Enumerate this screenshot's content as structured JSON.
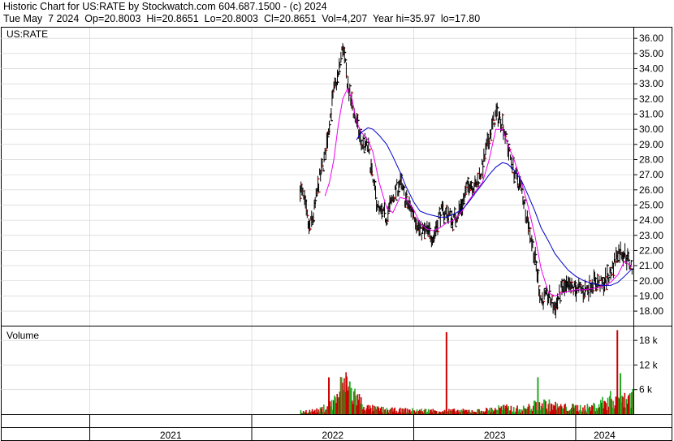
{
  "header": {
    "line1": "Historic Chart for US:RATE by Stockwatch.com 604.687.1500 - (c) 2024",
    "line2": "Tue May  7 2024  Op=20.8003  Hi=20.8651  Lo=20.8003  Cl=20.8651  Vol=4,207  Year hi=35.97  lo=17.80"
  },
  "colors": {
    "price_bar": "#000000",
    "down_close": "#cc0000",
    "ma_short": "#ee00ee",
    "ma_long": "#0000cc",
    "vol_up": "#22aa22",
    "vol_down": "#cc0000",
    "grid": "#cccccc"
  },
  "chart_data": [
    {
      "type": "line",
      "panel": "price",
      "title": "US:RATE",
      "ylim": [
        17.2,
        36.6
      ],
      "yticks": [
        "36.00",
        "35.00",
        "34.00",
        "33.00",
        "32.00",
        "31.00",
        "30.00",
        "29.00",
        "28.00",
        "27.00",
        "26.00",
        "25.00",
        "24.00",
        "23.00",
        "22.00",
        "21.00",
        "20.00",
        "19.00",
        "18.00"
      ],
      "x_labels": [
        "2021",
        "2022",
        "2023",
        "2024"
      ],
      "grid": true,
      "price_path": [
        [
          "2022-04-20",
          26.2
        ],
        [
          "2022-05-01",
          25.0
        ],
        [
          "2022-05-10",
          23.4
        ],
        [
          "2022-05-20",
          24.3
        ],
        [
          "2022-06-01",
          26.5
        ],
        [
          "2022-06-15",
          28.2
        ],
        [
          "2022-06-25",
          30.5
        ],
        [
          "2022-07-05",
          32.5
        ],
        [
          "2022-07-15",
          33.5
        ],
        [
          "2022-07-25",
          35.5
        ],
        [
          "2022-08-05",
          33.0
        ],
        [
          "2022-08-15",
          31.5
        ],
        [
          "2022-08-25",
          30.5
        ],
        [
          "2022-09-05",
          29.0
        ],
        [
          "2022-09-20",
          28.8
        ],
        [
          "2022-10-01",
          26.5
        ],
        [
          "2022-10-15",
          24.5
        ],
        [
          "2022-11-01",
          24.2
        ],
        [
          "2022-11-15",
          25.5
        ],
        [
          "2022-12-01",
          26.5
        ],
        [
          "2022-12-15",
          25.2
        ],
        [
          "2023-01-01",
          24.5
        ],
        [
          "2023-01-15",
          23.3
        ],
        [
          "2023-02-01",
          23.2
        ],
        [
          "2023-02-15",
          22.9
        ],
        [
          "2023-03-01",
          24.5
        ],
        [
          "2023-03-15",
          24.5
        ],
        [
          "2023-04-01",
          24.0
        ],
        [
          "2023-04-20",
          25.0
        ],
        [
          "2023-05-05",
          26.5
        ],
        [
          "2023-05-20",
          26.2
        ],
        [
          "2023-06-05",
          27.5
        ],
        [
          "2023-06-20",
          29.5
        ],
        [
          "2023-07-05",
          31.0
        ],
        [
          "2023-07-20",
          30.5
        ],
        [
          "2023-08-01",
          28.8
        ],
        [
          "2023-08-15",
          27.2
        ],
        [
          "2023-09-01",
          26.0
        ],
        [
          "2023-09-15",
          24.0
        ],
        [
          "2023-10-01",
          21.5
        ],
        [
          "2023-10-15",
          18.7
        ],
        [
          "2023-11-01",
          19.0
        ],
        [
          "2023-11-15",
          18.2
        ],
        [
          "2023-12-01",
          19.5
        ],
        [
          "2023-12-15",
          19.5
        ],
        [
          "2024-01-01",
          19.5
        ],
        [
          "2024-01-20",
          19.3
        ],
        [
          "2024-02-10",
          20.0
        ],
        [
          "2024-03-01",
          19.7
        ],
        [
          "2024-03-20",
          20.5
        ],
        [
          "2024-04-05",
          22.0
        ],
        [
          "2024-04-20",
          21.8
        ],
        [
          "2024-05-07",
          20.8651
        ]
      ],
      "series": [
        {
          "name": "",
          "role": "short moving average",
          "color": "#ee00ee",
          "points": [
            [
              "2022-06-15",
              25.6
            ],
            [
              "2022-06-25",
              26.5
            ],
            [
              "2022-07-05",
              28.0
            ],
            [
              "2022-07-15",
              30.3
            ],
            [
              "2022-07-25",
              32.0
            ],
            [
              "2022-08-05",
              32.7
            ],
            [
              "2022-08-15",
              32.0
            ],
            [
              "2022-08-25",
              30.5
            ],
            [
              "2022-09-05",
              29.8
            ],
            [
              "2022-09-20",
              29.3
            ],
            [
              "2022-10-01",
              28.5
            ],
            [
              "2022-10-15",
              26.5
            ],
            [
              "2022-11-01",
              24.8
            ],
            [
              "2022-11-15",
              24.5
            ],
            [
              "2022-12-01",
              25.5
            ],
            [
              "2022-12-15",
              25.4
            ],
            [
              "2023-01-01",
              24.7
            ],
            [
              "2023-01-15",
              23.8
            ],
            [
              "2023-02-01",
              23.4
            ],
            [
              "2023-02-15",
              23.3
            ],
            [
              "2023-03-01",
              23.5
            ],
            [
              "2023-03-15",
              23.8
            ],
            [
              "2023-04-01",
              24.0
            ],
            [
              "2023-04-20",
              24.6
            ],
            [
              "2023-05-05",
              25.3
            ],
            [
              "2023-05-20",
              25.9
            ],
            [
              "2023-06-05",
              26.5
            ],
            [
              "2023-06-20",
              28.0
            ],
            [
              "2023-07-05",
              30.0
            ],
            [
              "2023-07-20",
              30.0
            ],
            [
              "2023-08-01",
              29.0
            ],
            [
              "2023-08-15",
              28.0
            ],
            [
              "2023-09-01",
              26.5
            ],
            [
              "2023-09-15",
              25.0
            ],
            [
              "2023-10-01",
              23.0
            ],
            [
              "2023-10-15",
              20.8
            ],
            [
              "2023-11-01",
              19.2
            ],
            [
              "2023-11-15",
              19.0
            ],
            [
              "2023-12-01",
              19.2
            ],
            [
              "2023-12-15",
              19.3
            ],
            [
              "2024-01-01",
              19.4
            ],
            [
              "2024-01-20",
              19.4
            ],
            [
              "2024-02-10",
              19.5
            ],
            [
              "2024-03-01",
              19.6
            ],
            [
              "2024-03-20",
              19.9
            ],
            [
              "2024-04-05",
              20.4
            ],
            [
              "2024-04-20",
              21.3
            ],
            [
              "2024-05-07",
              20.9
            ]
          ]
        },
        {
          "name": "",
          "role": "long moving average",
          "color": "#0000cc",
          "points": [
            [
              "2022-08-25",
              29.3
            ],
            [
              "2022-09-05",
              29.8
            ],
            [
              "2022-09-20",
              30.1
            ],
            [
              "2022-10-01",
              30.0
            ],
            [
              "2022-10-15",
              29.6
            ],
            [
              "2022-11-01",
              29.0
            ],
            [
              "2022-11-15",
              28.2
            ],
            [
              "2022-12-01",
              27.2
            ],
            [
              "2022-12-15",
              26.2
            ],
            [
              "2023-01-01",
              25.2
            ],
            [
              "2023-01-15",
              24.6
            ],
            [
              "2023-02-01",
              24.4
            ],
            [
              "2023-02-15",
              24.3
            ],
            [
              "2023-03-01",
              24.2
            ],
            [
              "2023-03-15",
              24.2
            ],
            [
              "2023-04-01",
              24.4
            ],
            [
              "2023-04-20",
              24.7
            ],
            [
              "2023-05-05",
              25.2
            ],
            [
              "2023-05-20",
              25.8
            ],
            [
              "2023-06-05",
              26.4
            ],
            [
              "2023-06-20",
              27.0
            ],
            [
              "2023-07-05",
              27.5
            ],
            [
              "2023-07-20",
              27.8
            ],
            [
              "2023-08-01",
              27.7
            ],
            [
              "2023-08-15",
              27.3
            ],
            [
              "2023-09-01",
              26.6
            ],
            [
              "2023-09-15",
              25.7
            ],
            [
              "2023-10-01",
              24.6
            ],
            [
              "2023-10-15",
              23.5
            ],
            [
              "2023-11-01",
              22.6
            ],
            [
              "2023-11-15",
              21.8
            ],
            [
              "2023-12-01",
              21.2
            ],
            [
              "2023-12-15",
              20.7
            ],
            [
              "2024-01-01",
              20.3
            ],
            [
              "2024-01-20",
              20.0
            ],
            [
              "2024-02-10",
              19.8
            ],
            [
              "2024-03-01",
              19.7
            ],
            [
              "2024-03-20",
              19.7
            ],
            [
              "2024-04-05",
              19.9
            ],
            [
              "2024-04-20",
              20.3
            ],
            [
              "2024-05-07",
              20.8
            ]
          ]
        }
      ]
    },
    {
      "type": "bar",
      "panel": "volume",
      "title": "Volume",
      "ylabel": "",
      "yticks": [
        "18 k",
        "12 k",
        "6 k"
      ],
      "ylim": [
        0,
        21000
      ],
      "grid": true,
      "volume_path": [
        [
          "2022-04-20",
          600
        ],
        [
          "2022-06-01",
          900
        ],
        [
          "2022-07-01",
          2500
        ],
        [
          "2022-07-25",
          7000
        ],
        [
          "2022-08-15",
          5000
        ],
        [
          "2022-09-15",
          1500
        ],
        [
          "2022-11-01",
          1000
        ],
        [
          "2023-01-01",
          900
        ],
        [
          "2023-03-15",
          800
        ],
        [
          "2023-06-01",
          800
        ],
        [
          "2023-07-15",
          1500
        ],
        [
          "2023-09-01",
          1200
        ],
        [
          "2023-10-15",
          2500
        ],
        [
          "2023-12-01",
          1600
        ],
        [
          "2024-02-01",
          1500
        ],
        [
          "2024-04-01",
          4000
        ],
        [
          "2024-05-07",
          4207
        ]
      ],
      "spikes": [
        [
          "2022-06-22",
          9000
        ],
        [
          "2022-07-20",
          9000
        ],
        [
          "2022-08-01",
          9200
        ],
        [
          "2022-08-08",
          8000
        ],
        [
          "2023-03-14",
          20000
        ],
        [
          "2023-10-06",
          9000
        ],
        [
          "2024-04-02",
          20500
        ],
        [
          "2024-04-09",
          10000
        ]
      ]
    }
  ]
}
